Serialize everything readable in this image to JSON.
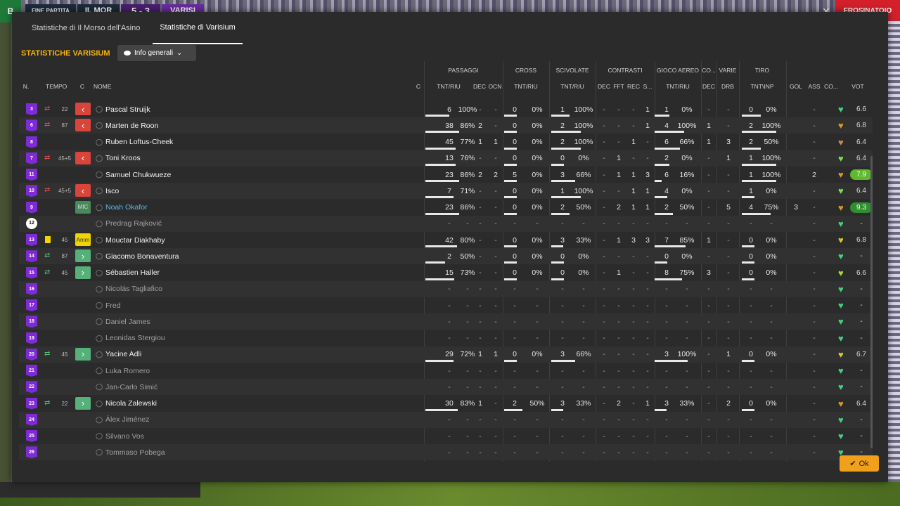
{
  "topbar": {
    "logo": "B",
    "label": "FINE PARTITA",
    "home_team": "IL MOR",
    "score": "5 - 3",
    "away_team": "VARISI",
    "close_glyph": "✕",
    "red_button": "FROSINATOIO"
  },
  "tabs": [
    "Statistiche di Il Morso dell'Asino",
    "Statistiche di Varisium"
  ],
  "section_title": "STATISTICHE VARISIUM",
  "view_select": {
    "label": "Info generali",
    "chevron": "⌄"
  },
  "groups": {
    "passaggi": "PASSAGGI",
    "cross": "CROSS",
    "scivolate": "SCIVOLATE",
    "contrasti": "CONTRASTI",
    "gioco_aereo": "GIOCO AEREO",
    "co": "CO...",
    "varie": "VARIE",
    "tiro": "TIRO"
  },
  "columns": {
    "n": "N.",
    "tempo": "TEMPO",
    "c": "C",
    "nome": "NOME",
    "c2": "C",
    "tnt_riu": "TNT/RIU",
    "dec": "DEC",
    "ocn": "OCN",
    "fft": "FFT",
    "rec": "REC",
    "s": "S...",
    "drb": "DRB",
    "tnt_inp": "TNT\\INP",
    "gol": "GOL",
    "ass": "ASS",
    "co": "CO...",
    "vot": "VOT"
  },
  "players": [
    {
      "n": "3",
      "sub": "out",
      "min": "22",
      "c": "red",
      "name": "Pascal Struijk",
      "ps": [
        "6",
        "100%"
      ],
      "pdec": "-",
      "pocn": "-",
      "cr": [
        "0",
        "0%"
      ],
      "sc": [
        "1",
        "100%"
      ],
      "cdec": "-",
      "cfft": "-",
      "crec": "-",
      "cs": "1",
      "ga": [
        "1",
        "0%"
      ],
      "codec": "-",
      "drb": "-",
      "ti": [
        "0",
        "0%"
      ],
      "gol": "",
      "ass": "-",
      "heart": "#44d17c",
      "vot": "6.6",
      "pbar": 0.6,
      "crbar": 0,
      "scbar": 0.5,
      "gabar": 0.4,
      "tibar": 0.5
    },
    {
      "n": "6",
      "sub": "out",
      "min": "87",
      "c": "red",
      "name": "Marten de Roon",
      "ps": [
        "38",
        "86%"
      ],
      "pdec": "2",
      "pocn": "-",
      "cr": [
        "0",
        "0%"
      ],
      "sc": [
        "2",
        "100%"
      ],
      "cdec": "-",
      "cfft": "-",
      "crec": "-",
      "cs": "1",
      "ga": [
        "4",
        "100%"
      ],
      "codec": "1",
      "drb": "-",
      "ti": [
        "2",
        "100%"
      ],
      "gol": "",
      "ass": "-",
      "heart": "#d69a2a",
      "vot": "6.8",
      "pbar": 0.86,
      "crbar": 0,
      "scbar": 0.8,
      "gabar": 0.8,
      "tibar": 0.9
    },
    {
      "n": "8",
      "sub": "",
      "min": "",
      "c": "",
      "name": "Ruben Loftus-Cheek",
      "ps": [
        "45",
        "77%"
      ],
      "pdec": "1",
      "pocn": "1",
      "cr": [
        "0",
        "0%"
      ],
      "sc": [
        "2",
        "100%"
      ],
      "cdec": "-",
      "cfft": "-",
      "crec": "1",
      "cs": "-",
      "ga": [
        "6",
        "66%"
      ],
      "codec": "1",
      "drb": "3",
      "ti": [
        "2",
        "50%"
      ],
      "gol": "",
      "ass": "-",
      "heart": "#c88a4e",
      "vot": "6.4",
      "pbar": 0.77,
      "crbar": 0,
      "scbar": 0.8,
      "gabar": 0.7,
      "tibar": 0.5
    },
    {
      "n": "7",
      "sub": "out",
      "min": "45+5",
      "c": "red",
      "name": "Toni Kroos",
      "ps": [
        "13",
        "76%"
      ],
      "pdec": "-",
      "pocn": "-",
      "cr": [
        "0",
        "0%"
      ],
      "sc": [
        "0",
        "0%"
      ],
      "cdec": "-",
      "cfft": "1",
      "crec": "-",
      "cs": "-",
      "ga": [
        "2",
        "0%"
      ],
      "codec": "-",
      "drb": "1",
      "ti": [
        "1",
        "100%"
      ],
      "gol": "",
      "ass": "-",
      "heart": "#7be04f",
      "vot": "6.4",
      "pbar": 0.76,
      "crbar": 0,
      "scbar": 0,
      "gabar": 0.4,
      "tibar": 0.9
    },
    {
      "n": "11",
      "sub": "",
      "min": "",
      "c": "",
      "name": "Samuel Chukwueze",
      "ps": [
        "23",
        "86%"
      ],
      "pdec": "2",
      "pocn": "2",
      "cr": [
        "5",
        "0%"
      ],
      "sc": [
        "3",
        "66%"
      ],
      "cdec": "-",
      "cfft": "1",
      "crec": "1",
      "cs": "3",
      "ga": [
        "6",
        "16%"
      ],
      "codec": "-",
      "drb": "-",
      "ti": [
        "1",
        "100%"
      ],
      "gol": "",
      "ass": "2",
      "heart": "#d69a2a",
      "vot": "7.9",
      "pbar": 0.86,
      "crbar": 0,
      "scbar": 0.66,
      "gabar": 0.2,
      "tibar": 0.9,
      "vot_style": "lime"
    },
    {
      "n": "10",
      "sub": "out",
      "min": "45+5",
      "c": "red",
      "name": "Isco",
      "ps": [
        "7",
        "71%"
      ],
      "pdec": "-",
      "pocn": "-",
      "cr": [
        "0",
        "0%"
      ],
      "sc": [
        "1",
        "100%"
      ],
      "cdec": "-",
      "cfft": "-",
      "crec": "1",
      "cs": "1",
      "ga": [
        "4",
        "0%"
      ],
      "codec": "-",
      "drb": "-",
      "ti": [
        "1",
        "0%"
      ],
      "gol": "",
      "ass": "-",
      "heart": "#7be04f",
      "vot": "6.4",
      "pbar": 0.71,
      "crbar": 0,
      "scbar": 0.8,
      "gabar": 0,
      "tibar": 0
    },
    {
      "n": "9",
      "sub": "",
      "min": "",
      "c": "mic",
      "name": "Noah Okafor",
      "ps": [
        "23",
        "86%"
      ],
      "pdec": "-",
      "pocn": "-",
      "cr": [
        "0",
        "0%"
      ],
      "sc": [
        "2",
        "50%"
      ],
      "cdec": "-",
      "cfft": "2",
      "crec": "1",
      "cs": "1",
      "ga": [
        "2",
        "50%"
      ],
      "codec": "-",
      "drb": "5",
      "ti": [
        "4",
        "75%"
      ],
      "gol": "3",
      "ass": "-",
      "heart": "#d69a2a",
      "vot": "9.3",
      "pbar": 0.86,
      "crbar": 0,
      "scbar": 0.5,
      "gabar": 0.5,
      "tibar": 0.75,
      "vot_style": "green",
      "link": true
    },
    {
      "n": "12",
      "sub": "",
      "min": "",
      "c": "",
      "name": "Predrag Rajković",
      "ps": [
        "-",
        "-"
      ],
      "pdec": "-",
      "pocn": "-",
      "cr": [
        "-",
        "-"
      ],
      "sc": [
        "-",
        "-"
      ],
      "cdec": "-",
      "cfft": "-",
      "crec": "-",
      "cs": "-",
      "ga": [
        "-",
        "-"
      ],
      "codec": "-",
      "drb": "-",
      "ti": [
        "-",
        "-"
      ],
      "gol": "",
      "ass": "-",
      "heart": "#44d17c",
      "vot": "-",
      "gk": true
    },
    {
      "n": "13",
      "sub": "yellow",
      "min": "45",
      "c": "amm",
      "name": "Mouctar Diakhaby",
      "ps": [
        "42",
        "80%"
      ],
      "pdec": "-",
      "pocn": "-",
      "cr": [
        "0",
        "0%"
      ],
      "sc": [
        "3",
        "33%"
      ],
      "cdec": "-",
      "cfft": "1",
      "crec": "3",
      "cs": "3",
      "ga": [
        "7",
        "85%"
      ],
      "codec": "1",
      "drb": "-",
      "ti": [
        "0",
        "0%"
      ],
      "gol": "",
      "ass": "-",
      "heart": "#d7c82d",
      "vot": "6.8",
      "pbar": 0.8,
      "crbar": 0,
      "scbar": 0.33,
      "gabar": 0.85,
      "tibar": 0
    },
    {
      "n": "14",
      "sub": "in",
      "min": "87",
      "c": "green",
      "name": "Giacomo Bonaventura",
      "ps": [
        "2",
        "50%"
      ],
      "pdec": "-",
      "pocn": "-",
      "cr": [
        "0",
        "0%"
      ],
      "sc": [
        "0",
        "0%"
      ],
      "cdec": "-",
      "cfft": "-",
      "crec": "-",
      "cs": "-",
      "ga": [
        "0",
        "0%"
      ],
      "codec": "-",
      "drb": "-",
      "ti": [
        "0",
        "0%"
      ],
      "gol": "",
      "ass": "-",
      "heart": "#44d17c",
      "vot": "-",
      "pbar": 0.5,
      "crbar": 0,
      "scbar": 0,
      "gabar": 0,
      "tibar": 0
    },
    {
      "n": "15",
      "sub": "in",
      "min": "45",
      "c": "green",
      "name": "Sébastien Haller",
      "ps": [
        "15",
        "73%"
      ],
      "pdec": "-",
      "pocn": "-",
      "cr": [
        "0",
        "0%"
      ],
      "sc": [
        "0",
        "0%"
      ],
      "cdec": "-",
      "cfft": "1",
      "crec": "-",
      "cs": "-",
      "ga": [
        "8",
        "75%"
      ],
      "codec": "3",
      "drb": "-",
      "ti": [
        "0",
        "0%"
      ],
      "gol": "",
      "ass": "-",
      "heart": "#a8d936",
      "vot": "6.6",
      "pbar": 0.73,
      "crbar": 0,
      "scbar": 0,
      "gabar": 0.75,
      "tibar": 0
    },
    {
      "n": "16",
      "sub": "",
      "min": "",
      "c": "",
      "name": "Nicolás Tagliafico",
      "ps": [
        "-",
        "-"
      ],
      "pdec": "-",
      "pocn": "-",
      "cr": [
        "-",
        "-"
      ],
      "sc": [
        "-",
        "-"
      ],
      "cdec": "-",
      "cfft": "-",
      "crec": "-",
      "cs": "-",
      "ga": [
        "-",
        "-"
      ],
      "codec": "-",
      "drb": "-",
      "ti": [
        "-",
        "-"
      ],
      "gol": "",
      "ass": "-",
      "heart": "#44d17c",
      "vot": "-"
    },
    {
      "n": "17",
      "sub": "",
      "min": "",
      "c": "",
      "name": "Fred",
      "ps": [
        "-",
        "-"
      ],
      "pdec": "-",
      "pocn": "-",
      "cr": [
        "-",
        "-"
      ],
      "sc": [
        "-",
        "-"
      ],
      "cdec": "-",
      "cfft": "-",
      "crec": "-",
      "cs": "-",
      "ga": [
        "-",
        "-"
      ],
      "codec": "-",
      "drb": "-",
      "ti": [
        "-",
        "-"
      ],
      "gol": "",
      "ass": "-",
      "heart": "#44d17c",
      "vot": "-"
    },
    {
      "n": "18",
      "sub": "",
      "min": "",
      "c": "",
      "name": "Daniel James",
      "ps": [
        "-",
        "-"
      ],
      "pdec": "-",
      "pocn": "-",
      "cr": [
        "-",
        "-"
      ],
      "sc": [
        "-",
        "-"
      ],
      "cdec": "-",
      "cfft": "-",
      "crec": "-",
      "cs": "-",
      "ga": [
        "-",
        "-"
      ],
      "codec": "-",
      "drb": "-",
      "ti": [
        "-",
        "-"
      ],
      "gol": "",
      "ass": "-",
      "heart": "#44d17c",
      "vot": "-"
    },
    {
      "n": "19",
      "sub": "",
      "min": "",
      "c": "",
      "name": "Leonidas Stergiou",
      "ps": [
        "-",
        "-"
      ],
      "pdec": "-",
      "pocn": "-",
      "cr": [
        "-",
        "-"
      ],
      "sc": [
        "-",
        "-"
      ],
      "cdec": "-",
      "cfft": "-",
      "crec": "-",
      "cs": "-",
      "ga": [
        "-",
        "-"
      ],
      "codec": "-",
      "drb": "-",
      "ti": [
        "-",
        "-"
      ],
      "gol": "",
      "ass": "-",
      "heart": "#44d17c",
      "vot": "-"
    },
    {
      "n": "20",
      "sub": "in",
      "min": "45",
      "c": "green",
      "name": "Yacine Adli",
      "ps": [
        "29",
        "72%"
      ],
      "pdec": "1",
      "pocn": "1",
      "cr": [
        "0",
        "0%"
      ],
      "sc": [
        "3",
        "66%"
      ],
      "cdec": "-",
      "cfft": "-",
      "crec": "-",
      "cs": "-",
      "ga": [
        "3",
        "100%"
      ],
      "codec": "-",
      "drb": "1",
      "ti": [
        "0",
        "0%"
      ],
      "gol": "",
      "ass": "-",
      "heart": "#d7c82d",
      "vot": "6.7",
      "pbar": 0.72,
      "crbar": 0,
      "scbar": 0.66,
      "gabar": 0.9,
      "tibar": 0
    },
    {
      "n": "21",
      "sub": "",
      "min": "",
      "c": "",
      "name": "Luka Romero",
      "ps": [
        "-",
        "-"
      ],
      "pdec": "-",
      "pocn": "-",
      "cr": [
        "-",
        "-"
      ],
      "sc": [
        "-",
        "-"
      ],
      "cdec": "-",
      "cfft": "-",
      "crec": "-",
      "cs": "-",
      "ga": [
        "-",
        "-"
      ],
      "codec": "-",
      "drb": "-",
      "ti": [
        "-",
        "-"
      ],
      "gol": "",
      "ass": "-",
      "heart": "#44d17c",
      "vot": "-"
    },
    {
      "n": "22",
      "sub": "",
      "min": "",
      "c": "",
      "name": "Jan-Carlo Simić",
      "ps": [
        "-",
        "-"
      ],
      "pdec": "-",
      "pocn": "-",
      "cr": [
        "-",
        "-"
      ],
      "sc": [
        "-",
        "-"
      ],
      "cdec": "-",
      "cfft": "-",
      "crec": "-",
      "cs": "-",
      "ga": [
        "-",
        "-"
      ],
      "codec": "-",
      "drb": "-",
      "ti": [
        "-",
        "-"
      ],
      "gol": "",
      "ass": "-",
      "heart": "#44d17c",
      "vot": "-"
    },
    {
      "n": "23",
      "sub": "in",
      "min": "22",
      "c": "green",
      "name": "Nicola Zalewski",
      "ps": [
        "30",
        "83%"
      ],
      "pdec": "1",
      "pocn": "-",
      "cr": [
        "2",
        "50%"
      ],
      "sc": [
        "3",
        "33%"
      ],
      "cdec": "-",
      "cfft": "2",
      "crec": "-",
      "cs": "1",
      "ga": [
        "3",
        "33%"
      ],
      "codec": "-",
      "drb": "2",
      "ti": [
        "0",
        "0%"
      ],
      "gol": "",
      "ass": "-",
      "heart": "#d69a2a",
      "vot": "6.4",
      "pbar": 0.83,
      "crbar": 0.5,
      "scbar": 0.33,
      "gabar": 0.33,
      "tibar": 0
    },
    {
      "n": "24",
      "sub": "",
      "min": "",
      "c": "",
      "name": "Álex Jiménez",
      "ps": [
        "-",
        "-"
      ],
      "pdec": "-",
      "pocn": "-",
      "cr": [
        "-",
        "-"
      ],
      "sc": [
        "-",
        "-"
      ],
      "cdec": "-",
      "cfft": "-",
      "crec": "-",
      "cs": "-",
      "ga": [
        "-",
        "-"
      ],
      "codec": "-",
      "drb": "-",
      "ti": [
        "-",
        "-"
      ],
      "gol": "",
      "ass": "-",
      "heart": "#44d17c",
      "vot": "-"
    },
    {
      "n": "25",
      "sub": "",
      "min": "",
      "c": "",
      "name": "Silvano Vos",
      "ps": [
        "-",
        "-"
      ],
      "pdec": "-",
      "pocn": "-",
      "cr": [
        "-",
        "-"
      ],
      "sc": [
        "-",
        "-"
      ],
      "cdec": "-",
      "cfft": "-",
      "crec": "-",
      "cs": "-",
      "ga": [
        "-",
        "-"
      ],
      "codec": "-",
      "drb": "-",
      "ti": [
        "-",
        "-"
      ],
      "gol": "",
      "ass": "-",
      "heart": "#44d17c",
      "vot": "-"
    },
    {
      "n": "26",
      "sub": "",
      "min": "",
      "c": "",
      "name": "Tommaso Pobega",
      "ps": [
        "-",
        "-"
      ],
      "pdec": "-",
      "pocn": "-",
      "cr": [
        "-",
        "-"
      ],
      "sc": [
        "-",
        "-"
      ],
      "cdec": "-",
      "cfft": "-",
      "crec": "-",
      "cs": "-",
      "ga": [
        "-",
        "-"
      ],
      "codec": "-",
      "drb": "-",
      "ti": [
        "-",
        "-"
      ],
      "gol": "",
      "ass": "-",
      "heart": "#44d17c",
      "vot": "-"
    }
  ],
  "badges": {
    "mic": "MIC",
    "amm": "Amm"
  },
  "ok_button": "Ok",
  "ok_check": "✔"
}
